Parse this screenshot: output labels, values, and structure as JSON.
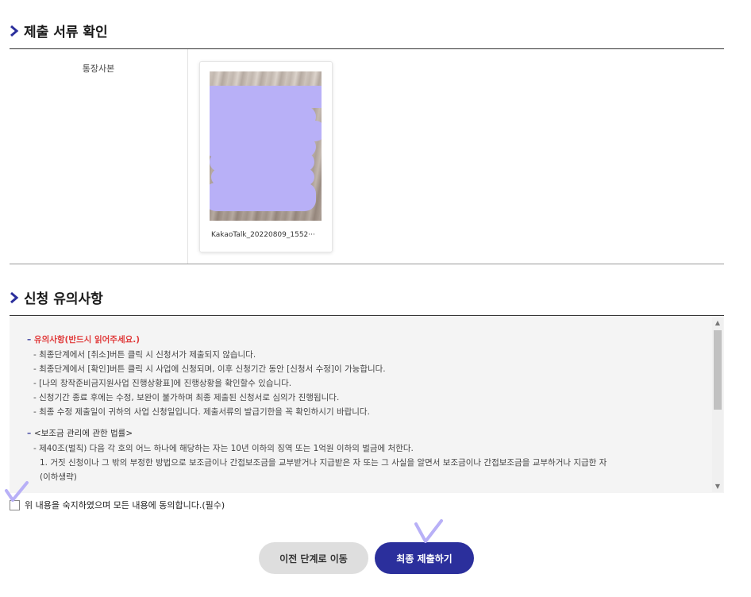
{
  "sections": {
    "documents_title": "제출 서류 확인",
    "notice_title": "신청 유의사항"
  },
  "documents": {
    "label": "통장사본",
    "file_name": "KakaoTalk_20220809_1552···"
  },
  "notice": {
    "group1_heading": "유의사항(반드시 읽어주세요.)",
    "group1_lines": [
      "- 최종단계에서 [취소]버튼 클릭 시 신청서가 제출되지 않습니다.",
      "- 최종단계에서 [확인]버튼 클릭 시 사업에 신청되며, 이후 신청기간 동안 [신청서 수정]이 가능합니다.",
      "- [나의 창작준비금지원사업 진행상황표]에 진행상황을 확인할수 있습니다.",
      "- 신청기간 종료 후에는 수정, 보완이 불가하며 최종 제출된 신청서로 심의가 진행됩니다.",
      "- 최종 수정 제출일이 귀하의 사업 신청일입니다. 제출서류의 발급기한을 꼭 확인하시기 바랍니다."
    ],
    "group2_heading": "<보조금 관리에 관한 법률>",
    "group2_line": "- 제40조(벌칙) 다음 각 호의 어느 하나에 해당하는 자는 10년 이하의 징역 또는 1억원 이하의 벌금에 처한다.",
    "group2_sub": "1. 거짓 신청이나 그 밖의 부정한 방법으로 보조금이나 간접보조금을 교부받거나 지급받은 자 또는 그 사실을 알면서 보조금이나 간접보조금을 교부하거나 지급한 자",
    "group2_sub2": "(이하생략)"
  },
  "agree": {
    "label": "위 내용을 숙지하였으며 모든 내용에 동의합니다.(필수)",
    "checked": false
  },
  "buttons": {
    "prev": "이전 단계로 이동",
    "submit": "최종 제출하기"
  },
  "colors": {
    "accent": "#2b2f9c",
    "heading_red": "#e03b3b",
    "annotation": "#b8b0f7"
  }
}
